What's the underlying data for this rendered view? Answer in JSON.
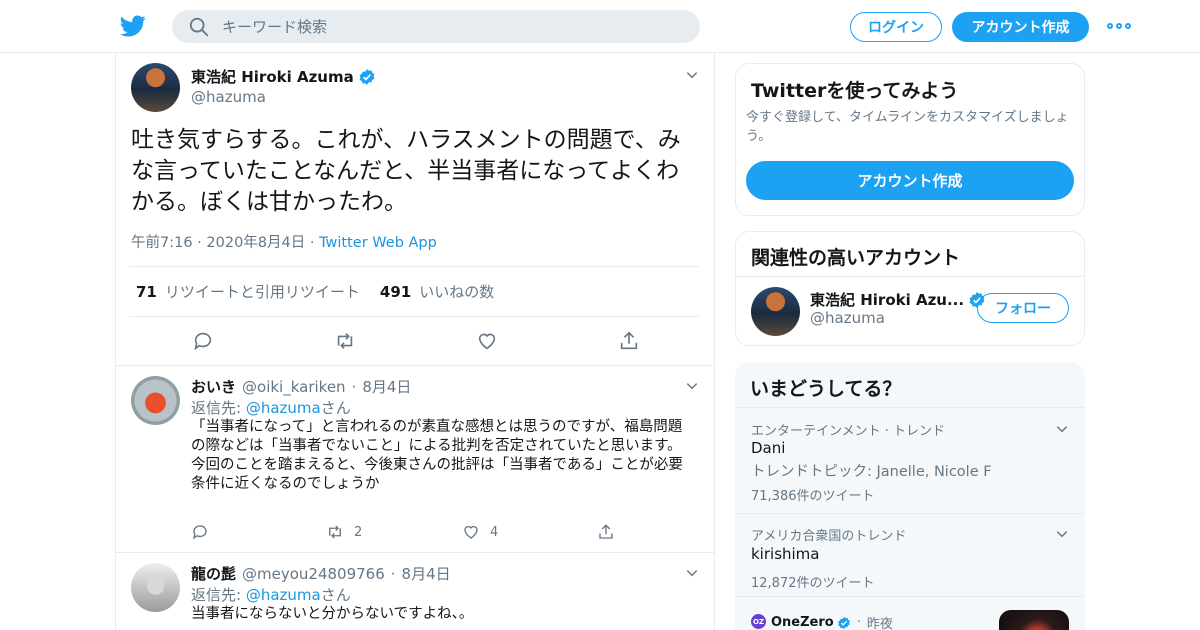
{
  "header": {
    "search_placeholder": "キーワード検索",
    "login_label": "ログイン",
    "signup_label": "アカウント作成"
  },
  "tweet": {
    "display_name": "東浩紀 Hiroki Azuma",
    "handle": "@hazuma",
    "text": "吐き気すらする。これが、ハラスメントの問題で、みな言っていたことなんだと、半当事者になってよくわかる。ぼくは甘かったわ。",
    "time": "午前7:16",
    "date": "2020年8月4日",
    "app": "Twitter Web App",
    "retweet_count": "71",
    "retweet_label": "リツイートと引用リツイート",
    "like_count": "491",
    "like_label": "いいねの数"
  },
  "replies": [
    {
      "display_name": "おいき",
      "handle": "@oiki_kariken",
      "date": "8月4日",
      "reply_to_prefix": "返信先: ",
      "reply_to_handle": "@hazuma",
      "reply_to_suffix": "さん",
      "line1": "「当事者になって」と言われるのが素直な感想とは思うのですが、福島問題の際などは「当事者でないこと」による批判を否定されていたと思います。",
      "line2": "今回のことを踏まえると、今後東さんの批評は「当事者である」ことが必要条件に近くなるのでしょうか",
      "retweets": "2",
      "likes": "4"
    },
    {
      "display_name": "龍の髭",
      "handle": "@meyou24809766",
      "date": "8月4日",
      "reply_to_prefix": "返信先: ",
      "reply_to_handle": "@hazuma",
      "reply_to_suffix": "さん",
      "line1": "当事者にならないと分からないですよね、。"
    }
  ],
  "signup_card": {
    "title": "Twitterを使ってみよう",
    "body": "今すぐ登録して、タイムラインをカスタマイズしましょう。",
    "button": "アカウント作成"
  },
  "related_card": {
    "title": "関連性の高いアカウント",
    "name": "東浩紀 Hiroki Azu...",
    "handle": "@hazuma",
    "follow_label": "フォロー"
  },
  "trends_card": {
    "title": "いまどうしてる？",
    "items": [
      {
        "context": "エンターテインメント · トレンド",
        "name": "Dani",
        "subtitle": "トレンドトピック: Janelle, Nicole F",
        "count": "71,386件のツイート"
      },
      {
        "context": "アメリカ合衆国のトレンド",
        "name": "kirishima",
        "count": "12,872件のツイート"
      }
    ],
    "news_source": "OneZero",
    "news_time": "昨夜"
  },
  "colors": {
    "accent": "#1da1f2",
    "link": "#1b95e0",
    "muted": "#657786",
    "border": "#e6ecf0"
  }
}
